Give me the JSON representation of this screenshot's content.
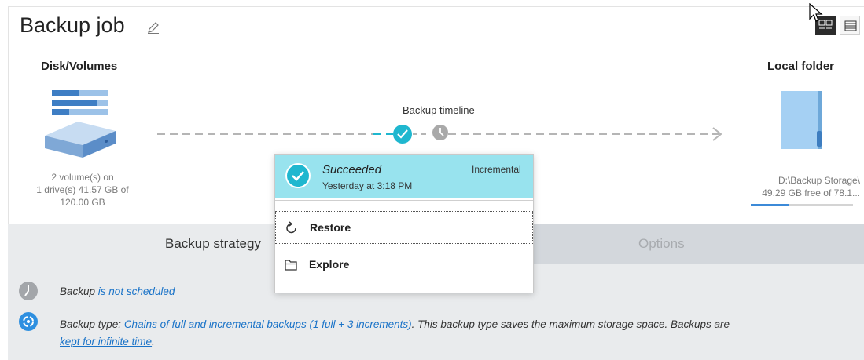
{
  "header": {
    "title": "Backup job",
    "edit_icon": "pencil-icon",
    "view_toggle": [
      "tiles-view-icon",
      "list-view-icon"
    ]
  },
  "source": {
    "label": "Disk/Volumes",
    "icon": "disk-icon",
    "desc_line1": "2 volume(s) on",
    "desc_line2": "1 drive(s) 41.57 GB of",
    "desc_line3": "120.00 GB"
  },
  "destination": {
    "label": "Local folder",
    "icon": "folder-icon",
    "path": "D:\\Backup Storage\\",
    "free": "49.29 GB free of 78.1...",
    "used_fraction": 0.37
  },
  "timeline": {
    "label": "Backup timeline"
  },
  "popup": {
    "status": "Succeeded",
    "time": "Yesterday at 3:18 PM",
    "kind": "Incremental",
    "items": [
      {
        "label": "Restore",
        "icon": "restore-icon"
      },
      {
        "label": "Explore",
        "icon": "folder-open-icon"
      }
    ]
  },
  "tabs": {
    "strategy": "Backup strategy",
    "options": "Options"
  },
  "strategy": {
    "schedule_prefix": "Backup",
    "schedule_link": "is not scheduled",
    "type_prefix": "Backup type:",
    "type_link": "Chains of full and incremental backups (1 full + 3 increments)",
    "type_suffix": ". This backup type saves the maximum storage space. Backups are",
    "retention_link": "kept for infinite time",
    "retention_suffix": "."
  },
  "colors": {
    "accent": "#1fb7cf",
    "popup_header": "#98e3ee",
    "link": "#1a73c8",
    "panel_gray": "#e9ebed"
  }
}
